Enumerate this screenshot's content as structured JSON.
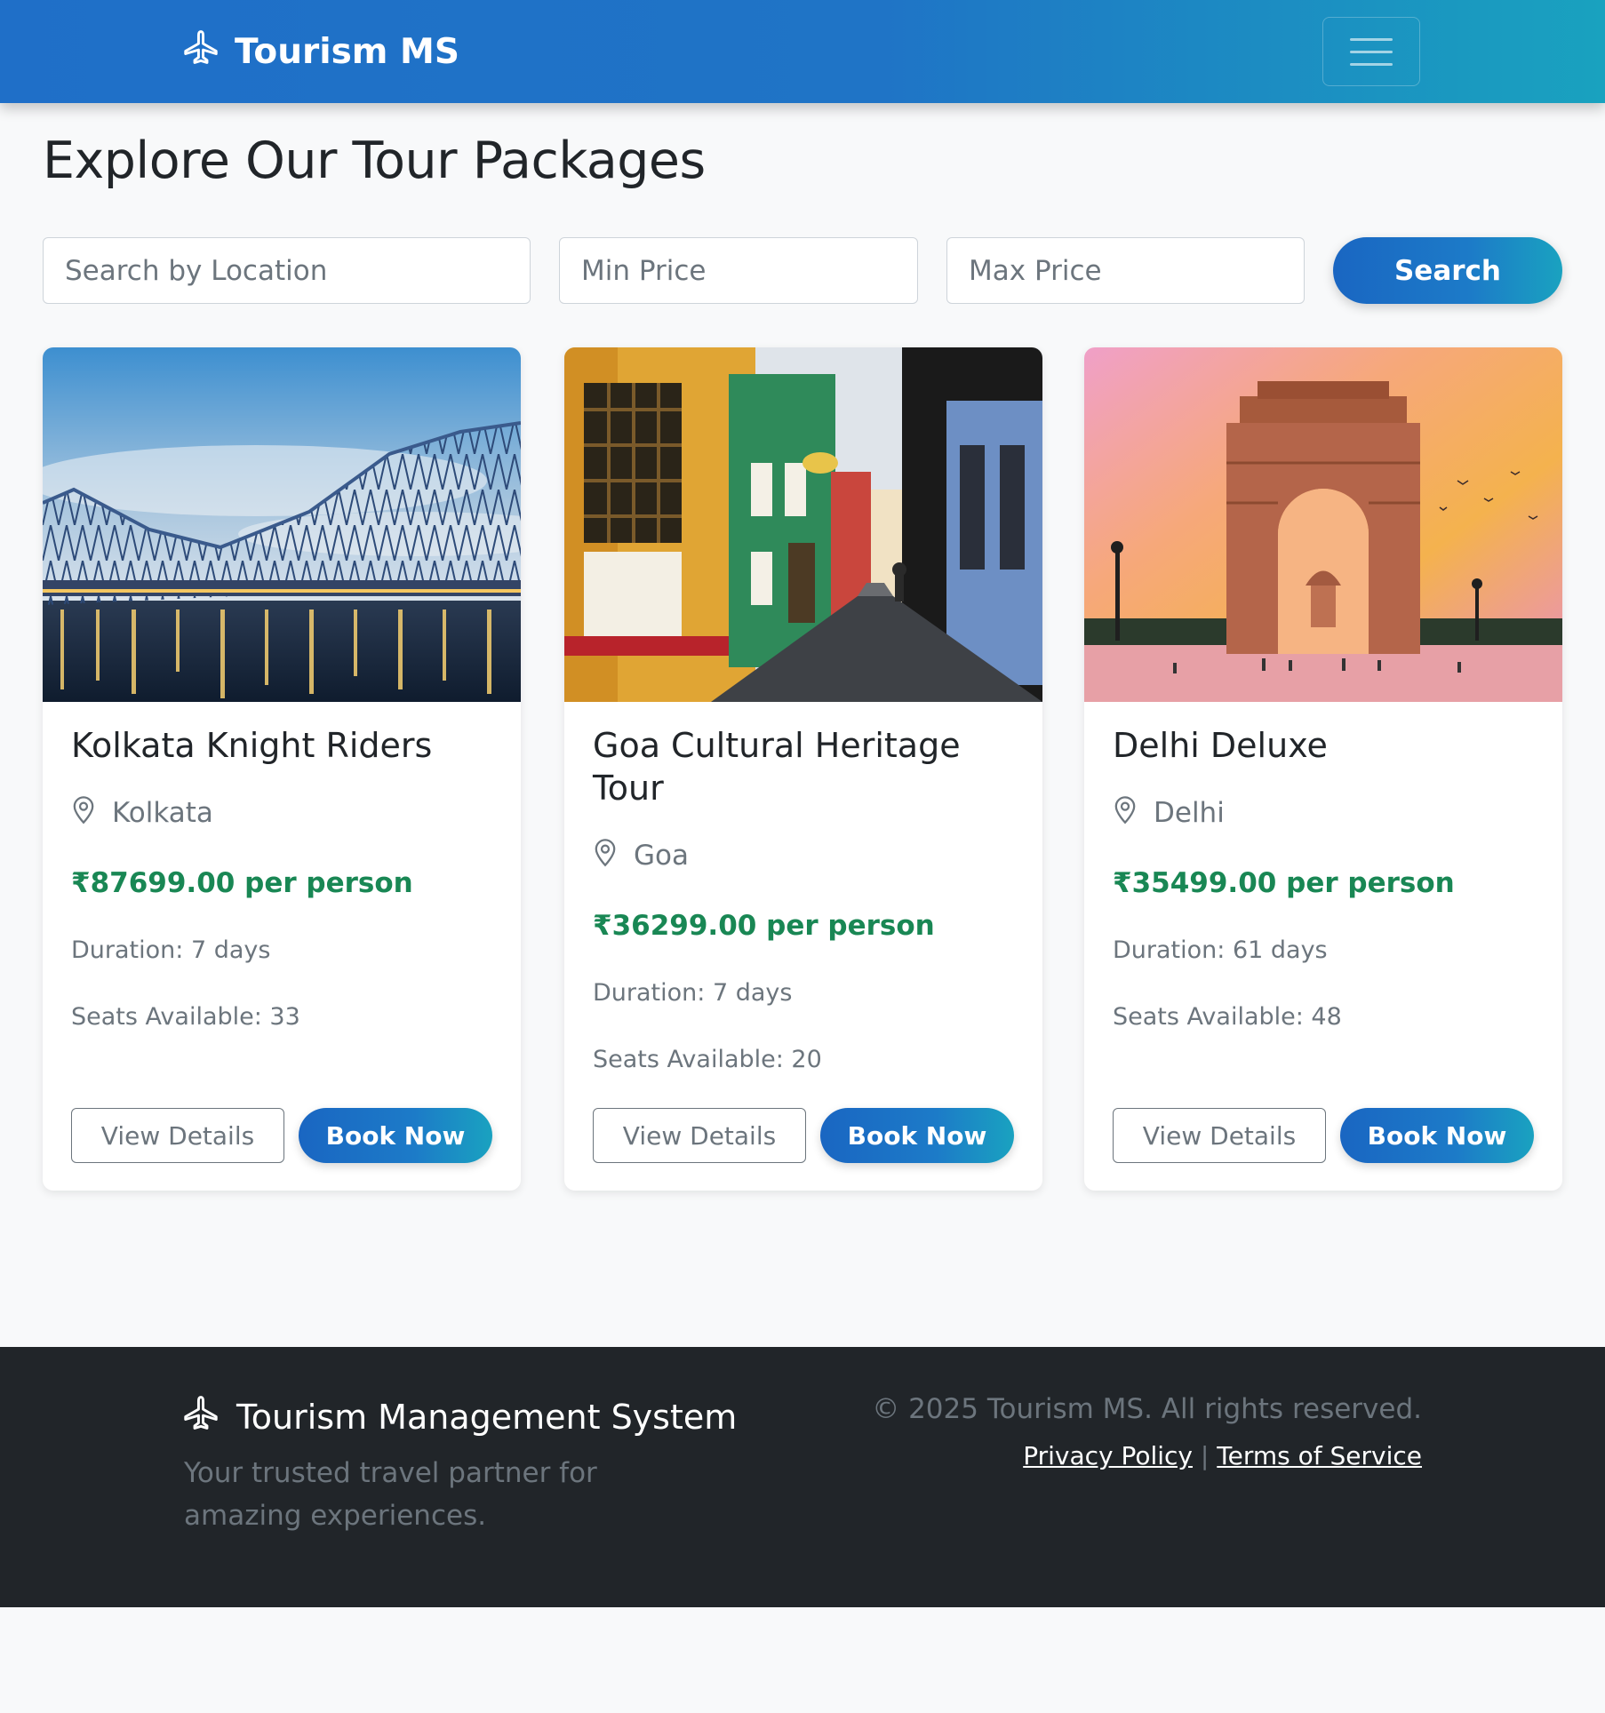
{
  "navbar": {
    "brand": "Tourism MS",
    "brand_icon": "airplane-icon",
    "menu_icon": "hamburger-menu-icon"
  },
  "page": {
    "title": "Explore Our Tour Packages"
  },
  "search": {
    "location_placeholder": "Search by Location",
    "location_value": "",
    "min_price_placeholder": "Min Price",
    "min_price_value": "",
    "max_price_placeholder": "Max Price",
    "max_price_value": "",
    "button_label": "Search"
  },
  "packages": [
    {
      "title": "Kolkata Knight Riders",
      "location": "Kolkata",
      "price": "₹87699.00 per person",
      "duration": "Duration: 7 days",
      "seats": "Seats Available: 33",
      "view_label": "View Details",
      "book_label": "Book Now"
    },
    {
      "title": "Goa Cultural Heritage Tour",
      "location": "Goa",
      "price": "₹36299.00 per person",
      "duration": "Duration: 7 days",
      "seats": "Seats Available: 20",
      "view_label": "View Details",
      "book_label": "Book Now"
    },
    {
      "title": "Delhi Deluxe",
      "location": "Delhi",
      "price": "₹35499.00 per person",
      "duration": "Duration: 61 days",
      "seats": "Seats Available: 48",
      "view_label": "View Details",
      "book_label": "Book Now"
    }
  ],
  "footer": {
    "brand": "Tourism Management System",
    "tagline": "Your trusted travel partner for amazing experiences.",
    "copyright": "© 2025 Tourism MS. All rights reserved.",
    "privacy_label": "Privacy Policy",
    "separator": "|",
    "terms_label": "Terms of Service"
  },
  "colors": {
    "primary": "#1f6fc8",
    "accent": "#19a2bf",
    "price_green": "#198754",
    "muted": "#6c757d",
    "footer_bg": "#212529"
  }
}
